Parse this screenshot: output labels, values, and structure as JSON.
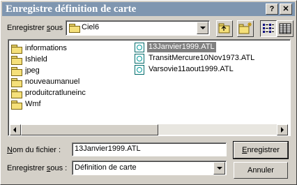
{
  "dialog": {
    "title": "Enregistre définition de carte",
    "help_label": "?",
    "close_label": "✕"
  },
  "save_in": {
    "label_pre": "Enregistrer ",
    "label_key": "s",
    "label_post": "ous :",
    "value": "Ciel6"
  },
  "folders": [
    "informations",
    "Ishield",
    "jpeg",
    "nouveaumanuel",
    "produitcratluneinc",
    "Wmf"
  ],
  "files": [
    "13Janvier1999.ATL",
    "TransitMercure10Nov1973.ATL",
    "Varsovie11aout1999.ATL"
  ],
  "selected_file": "13Janvier1999.ATL",
  "filename": {
    "label_key": "N",
    "label_post": "om du fichier :",
    "value": "13Janvier1999.ATL"
  },
  "save_as": {
    "label_pre": "Enregistrer ",
    "label_key": "s",
    "label_post": "ous :",
    "value": "Définition de carte"
  },
  "buttons": {
    "save_key": "E",
    "save_post": "nregistrer",
    "cancel": "Annuler"
  },
  "icons": {
    "up": "up-folder-icon",
    "new_folder": "new-folder-icon",
    "list_view": "list-view-icon",
    "details_view": "details-view-icon"
  },
  "colors": {
    "titlebar": "#7f96b0",
    "face": "#d4d0c8",
    "selection": "#808080"
  }
}
